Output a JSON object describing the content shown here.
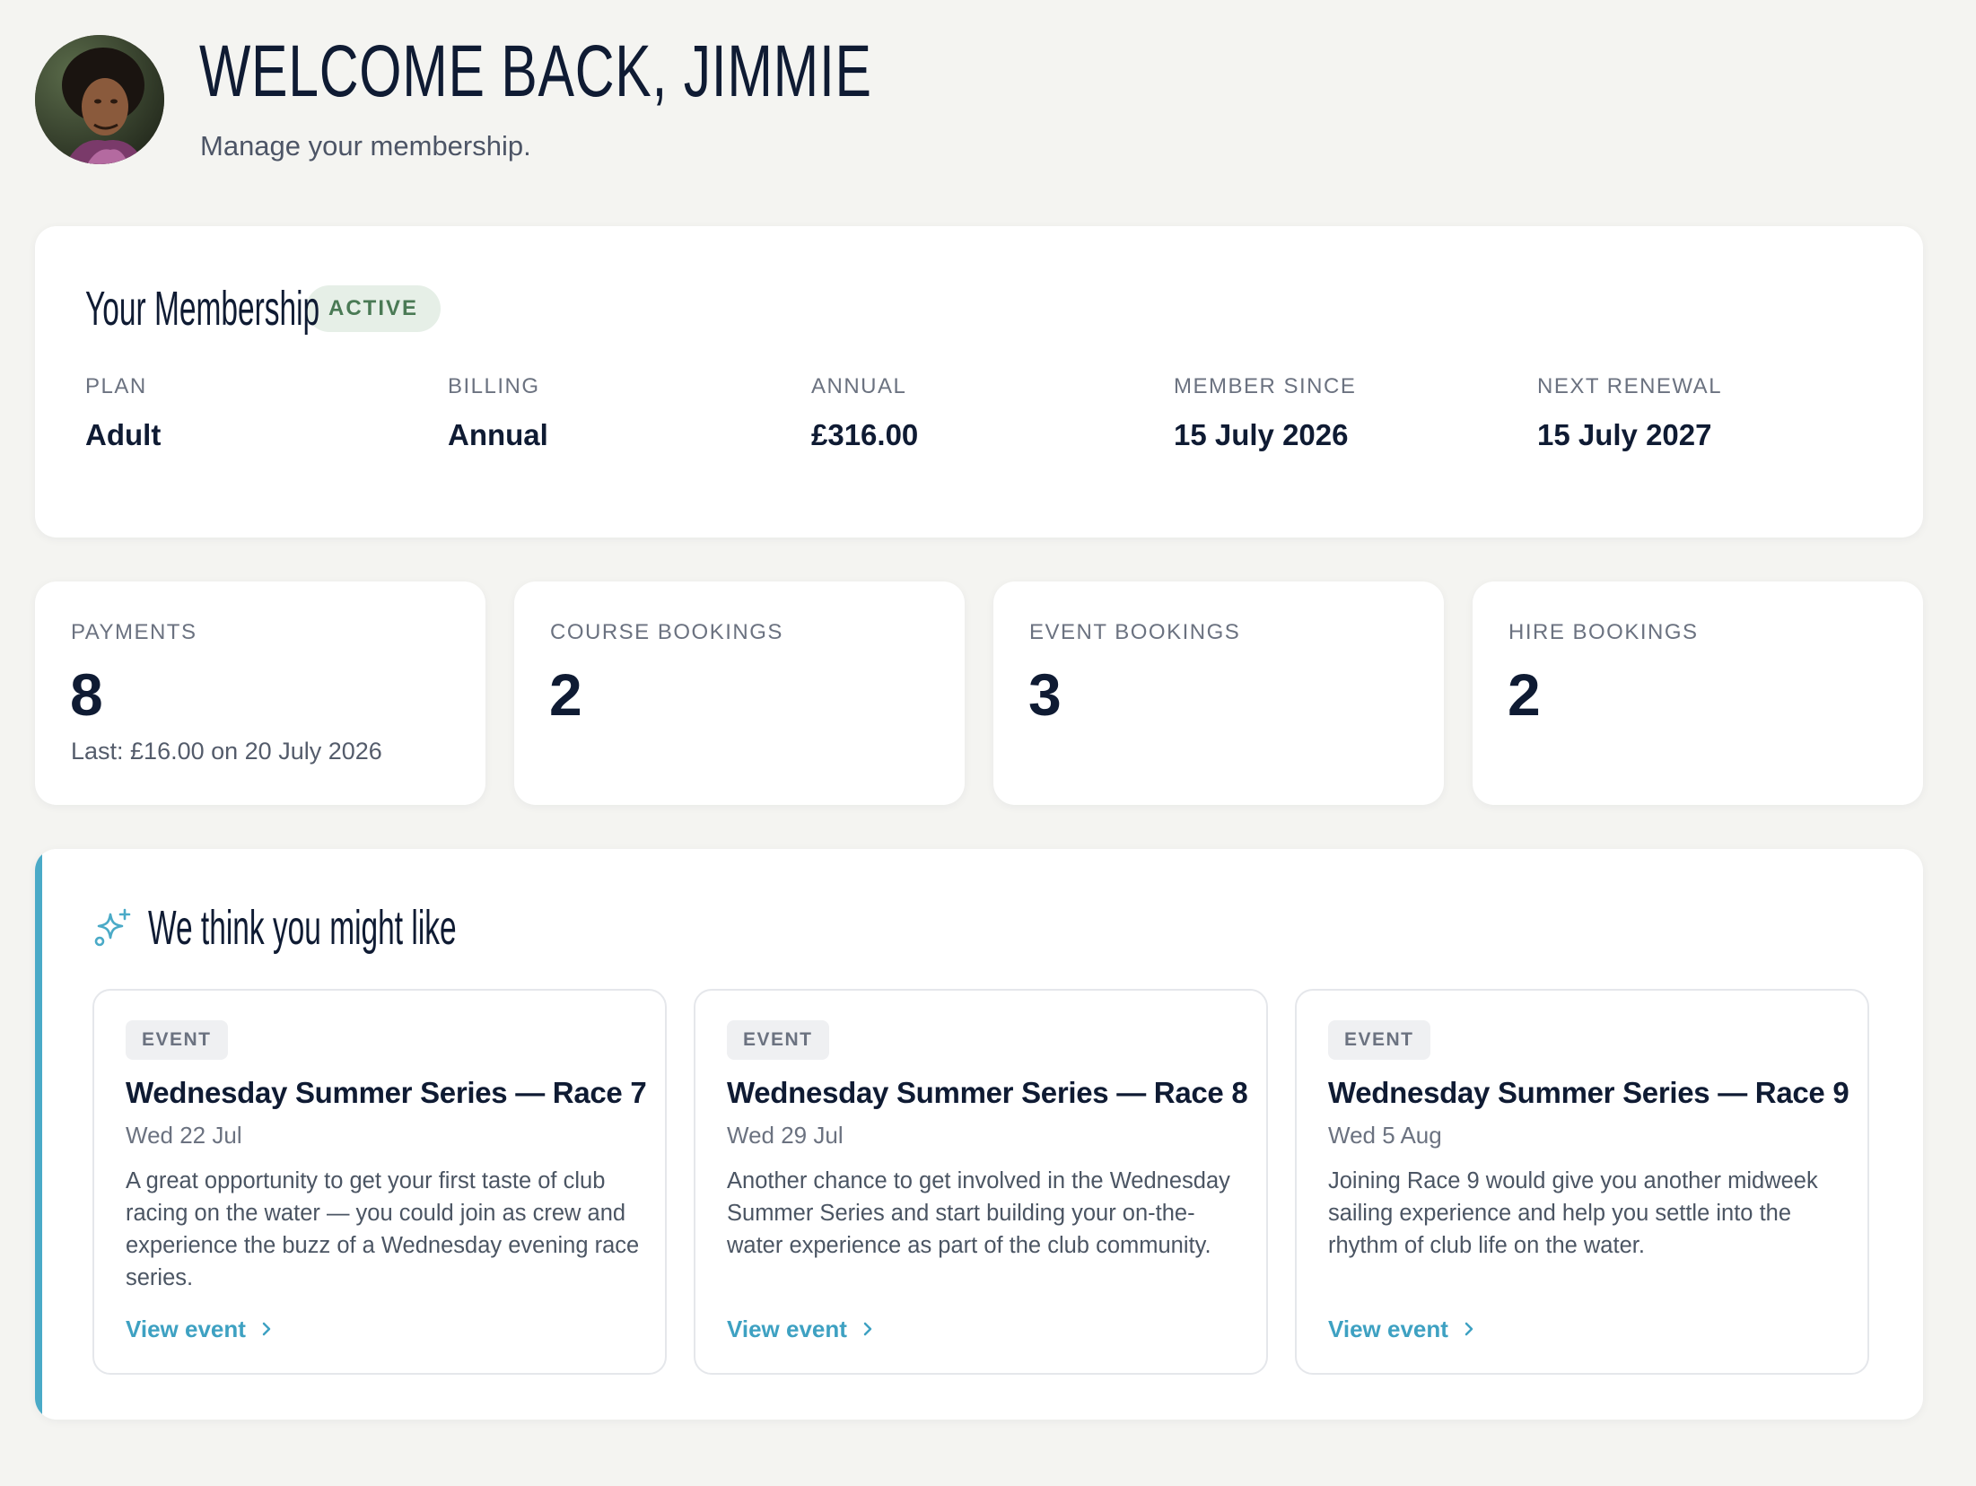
{
  "header": {
    "title": "WELCOME BACK, JIMMIE",
    "subtitle": "Manage your membership.",
    "avatar_icon": "user-avatar"
  },
  "membership": {
    "title": "Your Membership",
    "status": "ACTIVE",
    "fields": [
      {
        "label": "PLAN",
        "value": "Adult"
      },
      {
        "label": "BILLING",
        "value": "Annual"
      },
      {
        "label": "ANNUAL",
        "value": "£316.00"
      },
      {
        "label": "MEMBER SINCE",
        "value": "15 July 2026"
      },
      {
        "label": "NEXT RENEWAL",
        "value": "15 July 2027"
      }
    ]
  },
  "stats": [
    {
      "label": "PAYMENTS",
      "value": "8",
      "note": "Last: £16.00 on 20 July 2026"
    },
    {
      "label": "COURSE BOOKINGS",
      "value": "2"
    },
    {
      "label": "EVENT BOOKINGS",
      "value": "3"
    },
    {
      "label": "HIRE BOOKINGS",
      "value": "2"
    }
  ],
  "recommendations": {
    "title": "We think you might like",
    "icon": "sparkle-icon",
    "items": [
      {
        "tag": "EVENT",
        "title": "Wednesday Summer Series — Race 7",
        "date": "Wed 22 Jul",
        "description": "A great opportunity to get your first taste of club racing on the water — you could join as crew and experience the buzz of a Wednesday evening race series.",
        "link": "View event"
      },
      {
        "tag": "EVENT",
        "title": "Wednesday Summer Series — Race 8",
        "date": "Wed 29 Jul",
        "description": "Another chance to get involved in the Wednesday Summer Series and start building your on-the-water experience as part of the club community.",
        "link": "View event"
      },
      {
        "tag": "EVENT",
        "title": "Wednesday Summer Series — Race 9",
        "date": "Wed 5 Aug",
        "description": "Joining Race 9 would give you another midweek sailing experience and help you settle into the rhythm of club life on the water.",
        "link": "View event"
      }
    ]
  },
  "colors": {
    "background": "#f4f4f1",
    "text": "#0f1b33",
    "accent": "#4aaac7",
    "active_badge_bg": "#e6efe7",
    "active_badge_text": "#4a7a55"
  }
}
